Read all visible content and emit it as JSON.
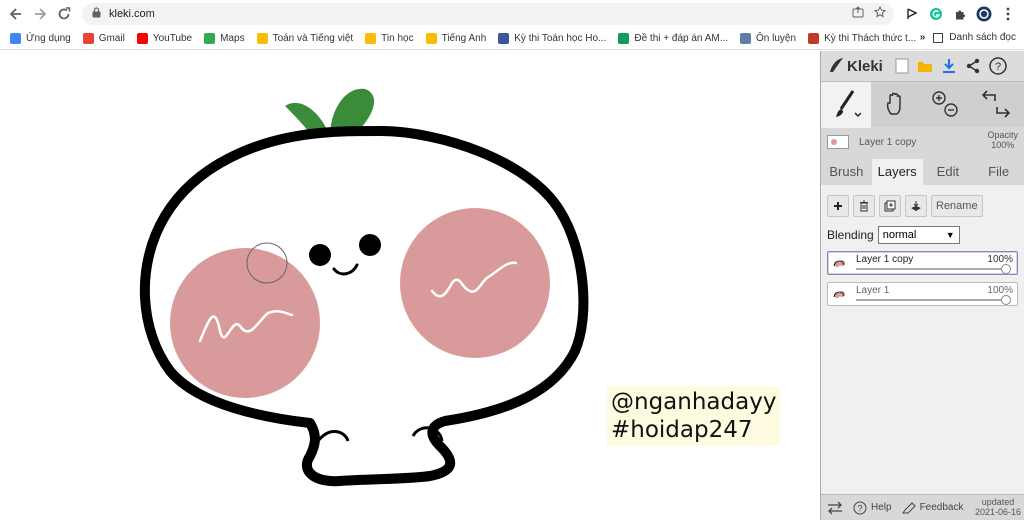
{
  "browser": {
    "url": "kleki.com",
    "bookmarks": [
      {
        "label": "Ứng dụng",
        "color": "#4285f4"
      },
      {
        "label": "Gmail",
        "color": "#ea4335"
      },
      {
        "label": "YouTube",
        "color": "#ff0000"
      },
      {
        "label": "Maps",
        "color": "#34a853"
      },
      {
        "label": "Toán và Tiếng việt",
        "color": "#fbbc04"
      },
      {
        "label": "Tin học",
        "color": "#fbbc04"
      },
      {
        "label": "Tiếng Anh",
        "color": "#fbbc04"
      },
      {
        "label": "Kỳ thi Toán học Ho...",
        "color": "#3b5998"
      },
      {
        "label": "Đề thi + đáp án AM...",
        "color": "#0f9d58"
      },
      {
        "label": "Ôn luyện",
        "color": "#5c7fa6"
      },
      {
        "label": "Kỳ thi Thách thức t...",
        "color": "#c0392b"
      }
    ],
    "more_label": "»",
    "reading_list": "Danh sách đọc"
  },
  "watermark": {
    "line1": "@nganhadayy",
    "line2": "#hoidap247"
  },
  "panel": {
    "logo": "Kleki",
    "current_layer": "Layer 1 copy",
    "opacity_label": "Opacity",
    "opacity_value": "100%",
    "tabs": [
      {
        "label": "Brush",
        "active": false
      },
      {
        "label": "Layers",
        "active": true
      },
      {
        "label": "Edit",
        "active": false
      },
      {
        "label": "File",
        "active": false
      }
    ],
    "rename_label": "Rename",
    "blending_label": "Blending",
    "blending_value": "normal",
    "layers": [
      {
        "name": "Layer 1 copy",
        "opacity": "100%",
        "selected": true
      },
      {
        "name": "Layer 1",
        "opacity": "100%",
        "selected": false
      }
    ],
    "help_label": "Help",
    "feedback_label": "Feedback",
    "updated_label": "updated",
    "updated_date": "2021-06-16"
  },
  "colors": {
    "sprout": "#3a8b3a",
    "cheek": "#d89a9a",
    "outline": "#000000",
    "accent_blue": "#1a73e8"
  }
}
